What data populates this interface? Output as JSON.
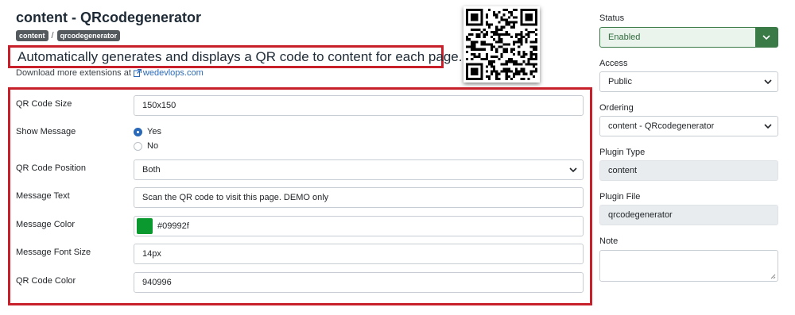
{
  "header": {
    "title": "content - QRcodegenerator",
    "breadcrumb": [
      "content",
      "qrcodegenerator"
    ],
    "breadcrumb_separator": "/",
    "description": "Automatically generates and displays a QR code to content for each page.",
    "download_text": "Download more extensions at",
    "download_link": "wedevlops.com"
  },
  "form": {
    "qr_code_size": {
      "label": "QR Code Size",
      "value": "150x150"
    },
    "show_message": {
      "label": "Show Message",
      "options": [
        "Yes",
        "No"
      ],
      "selected": "Yes"
    },
    "qr_code_position": {
      "label": "QR Code Position",
      "value": "Both"
    },
    "message_text": {
      "label": "Message Text",
      "value": "Scan the QR code to visit this page. DEMO only"
    },
    "message_color": {
      "label": "Message Color",
      "value": "#09992f",
      "swatch": "#09992f"
    },
    "message_font_size": {
      "label": "Message Font Size",
      "value": "14px"
    },
    "qr_code_color": {
      "label": "QR Code Color",
      "value": "940996"
    }
  },
  "sidebar": {
    "status": {
      "label": "Status",
      "value": "Enabled"
    },
    "access": {
      "label": "Access",
      "value": "Public"
    },
    "ordering": {
      "label": "Ordering",
      "value": "content - QRcodegenerator"
    },
    "plugin_type": {
      "label": "Plugin Type",
      "value": "content"
    },
    "plugin_file": {
      "label": "Plugin File",
      "value": "qrcodegenerator"
    },
    "note": {
      "label": "Note",
      "value": ""
    }
  },
  "icons": {
    "qr": "qr-code-image",
    "external_link": "external-link-icon",
    "chevron": "chevron-down-icon"
  },
  "colors": {
    "highlight_border": "#c8202a",
    "status_green": "#3a7a47",
    "link_blue": "#2a69b8",
    "message_color_swatch": "#09992f"
  }
}
